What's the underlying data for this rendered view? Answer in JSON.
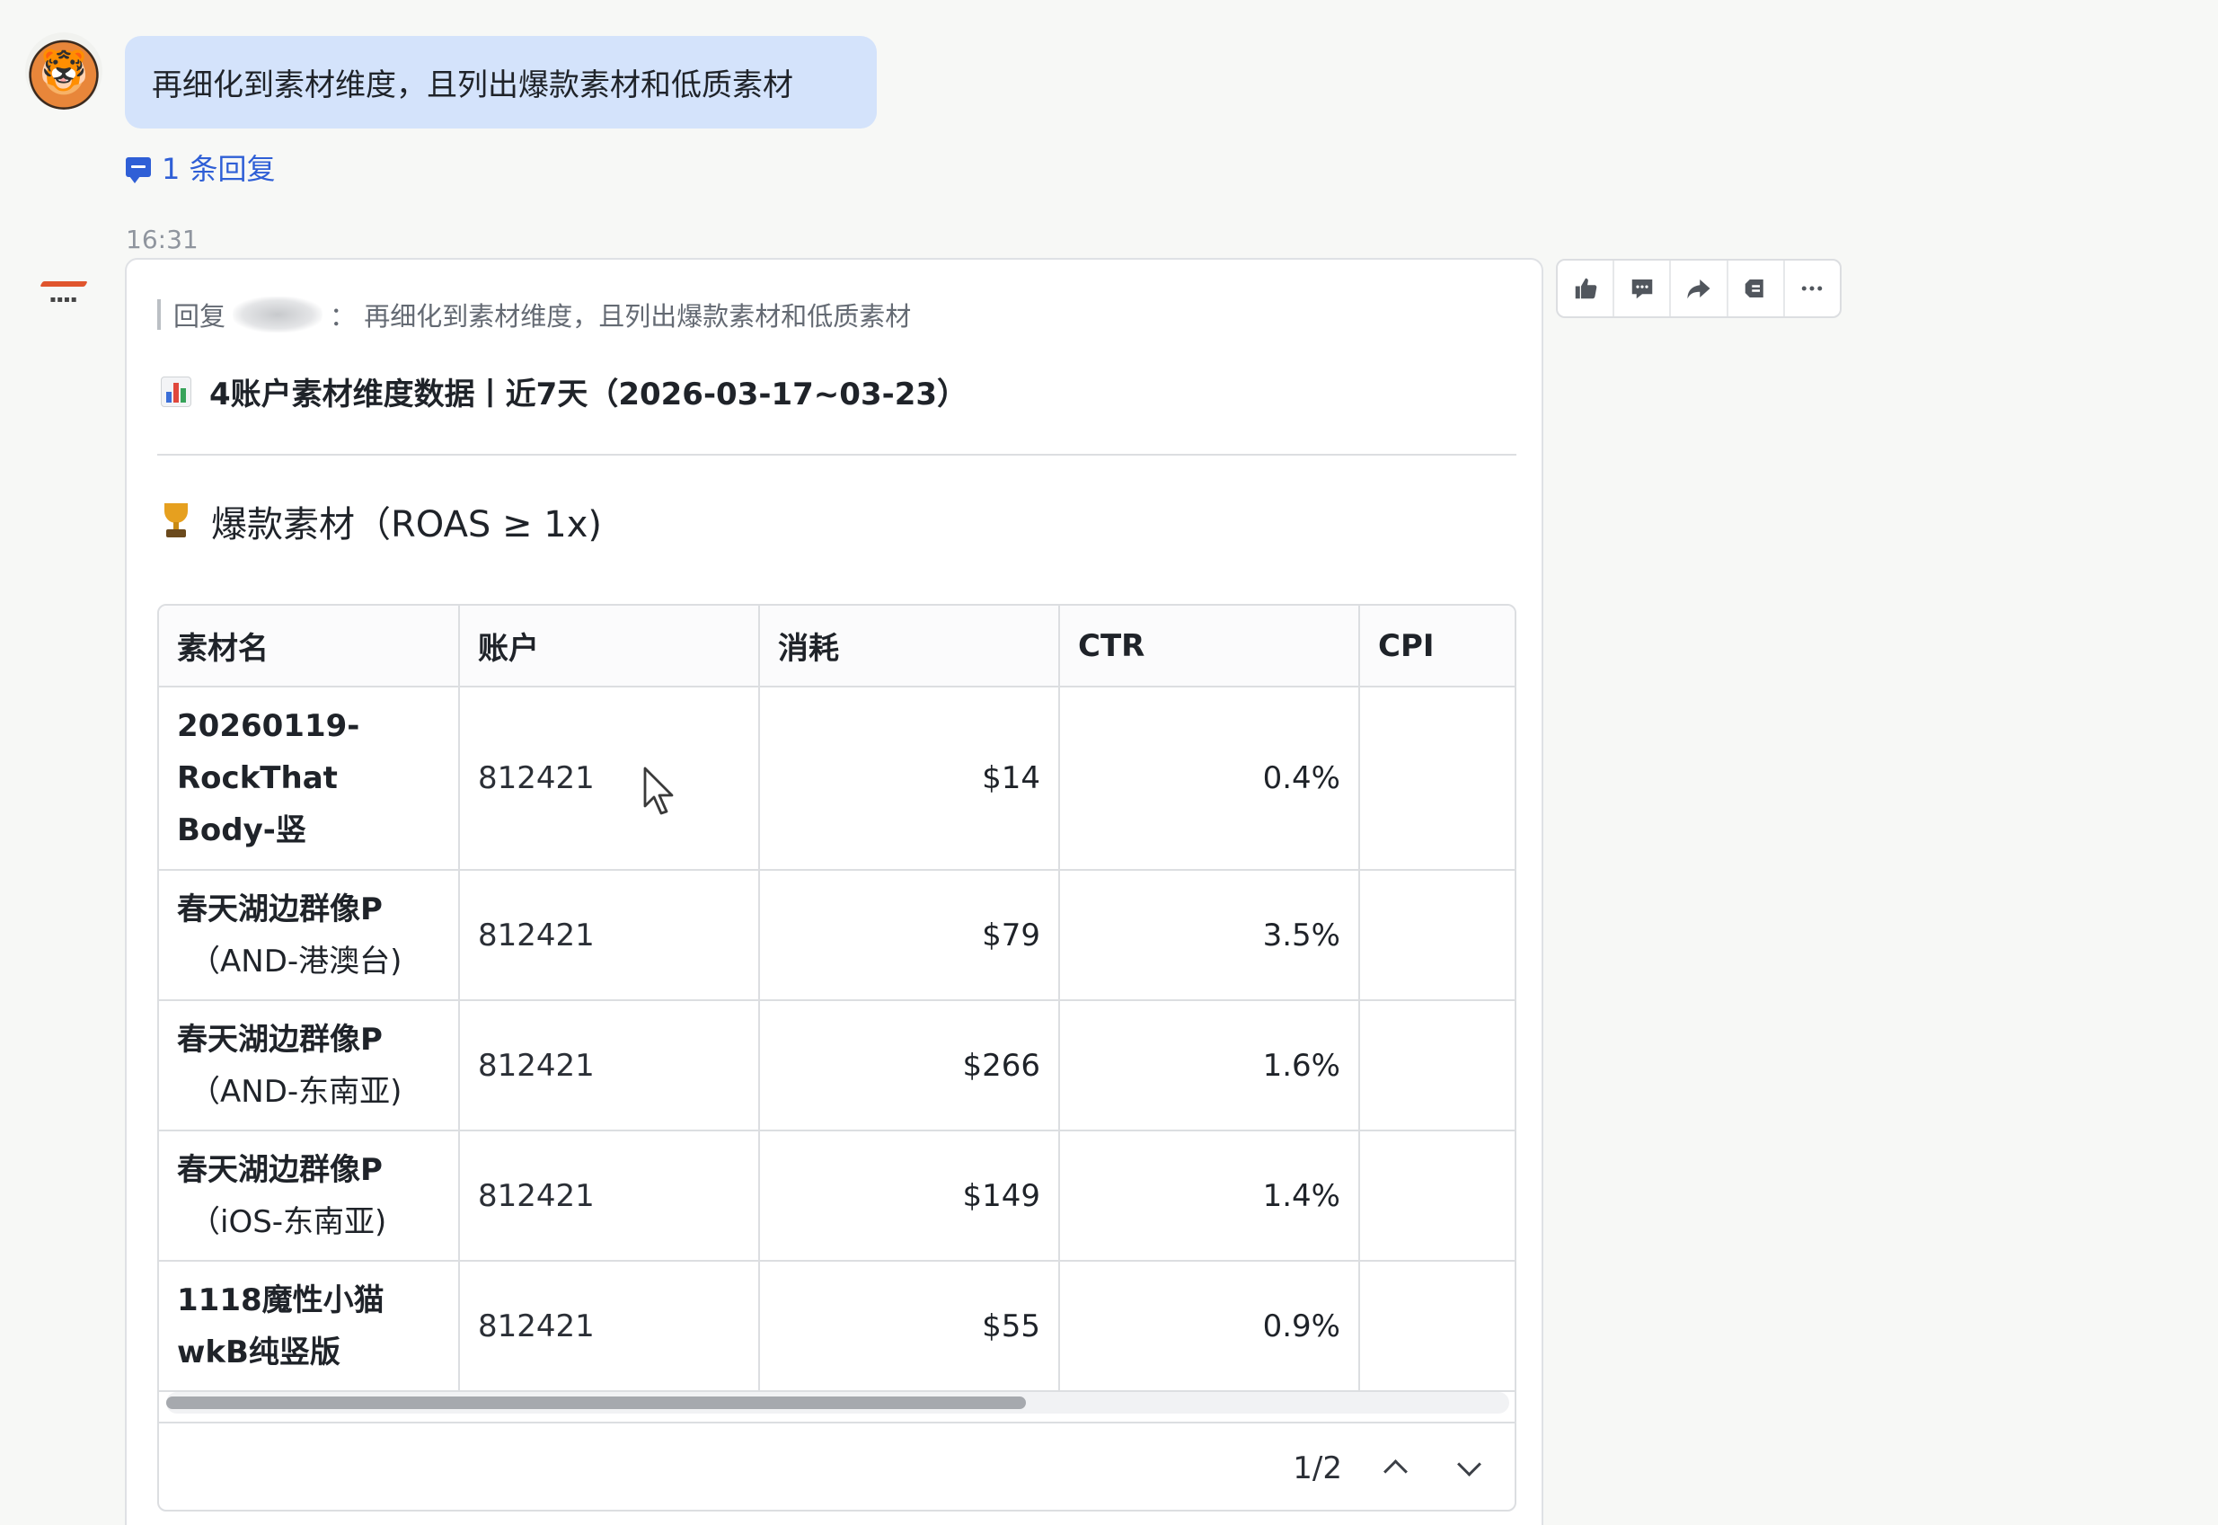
{
  "chat": {
    "user_message": "再细化到素材维度，且列出爆款素材和低质素材",
    "reply_count_label": "1 条回复",
    "timestamp": "16:31"
  },
  "bot_card": {
    "quote_prefix": "回复",
    "quote_suffix": "：  再细化到素材维度，且列出爆款素材和低质素材",
    "report_title": "4账户素材维度数据丨近7天（2026-03-17~03-23）",
    "section_title": "爆款素材（ROAS ≥ 1x)",
    "table": {
      "headers": [
        "素材名",
        "账户",
        "消耗",
        "CTR",
        "CPI"
      ],
      "rows": [
        {
          "name": "20260119-RockThat Body-竖",
          "name_line2": "",
          "account": "812421",
          "spend": "$14",
          "ctr": "0.4%",
          "cpi": ""
        },
        {
          "name": "春天湖边群像P",
          "name_line2": "（AND-港澳台)",
          "account": "812421",
          "spend": "$79",
          "ctr": "3.5%",
          "cpi": ""
        },
        {
          "name": "春天湖边群像P",
          "name_line2": "（AND-东南亚)",
          "account": "812421",
          "spend": "$266",
          "ctr": "1.6%",
          "cpi": ""
        },
        {
          "name": "春天湖边群像P",
          "name_line2": "（iOS-东南亚)",
          "account": "812421",
          "spend": "$149",
          "ctr": "1.4%",
          "cpi": ""
        },
        {
          "name": "1118魔性小猫wkB纯竖版",
          "name_line2": "",
          "account": "812421",
          "spend": "$55",
          "ctr": "0.9%",
          "cpi": ""
        }
      ],
      "pager": "1/2",
      "horizontal_scroll_fraction": 0.64
    }
  },
  "toolbar": {
    "icons": [
      "thumbs-up-icon",
      "comment-icon",
      "forward-icon",
      "pin-icon",
      "more-icon"
    ]
  },
  "colors": {
    "user_bubble": "#d4e3fb",
    "link_blue": "#2f5fd6",
    "border": "#dcdee1"
  }
}
